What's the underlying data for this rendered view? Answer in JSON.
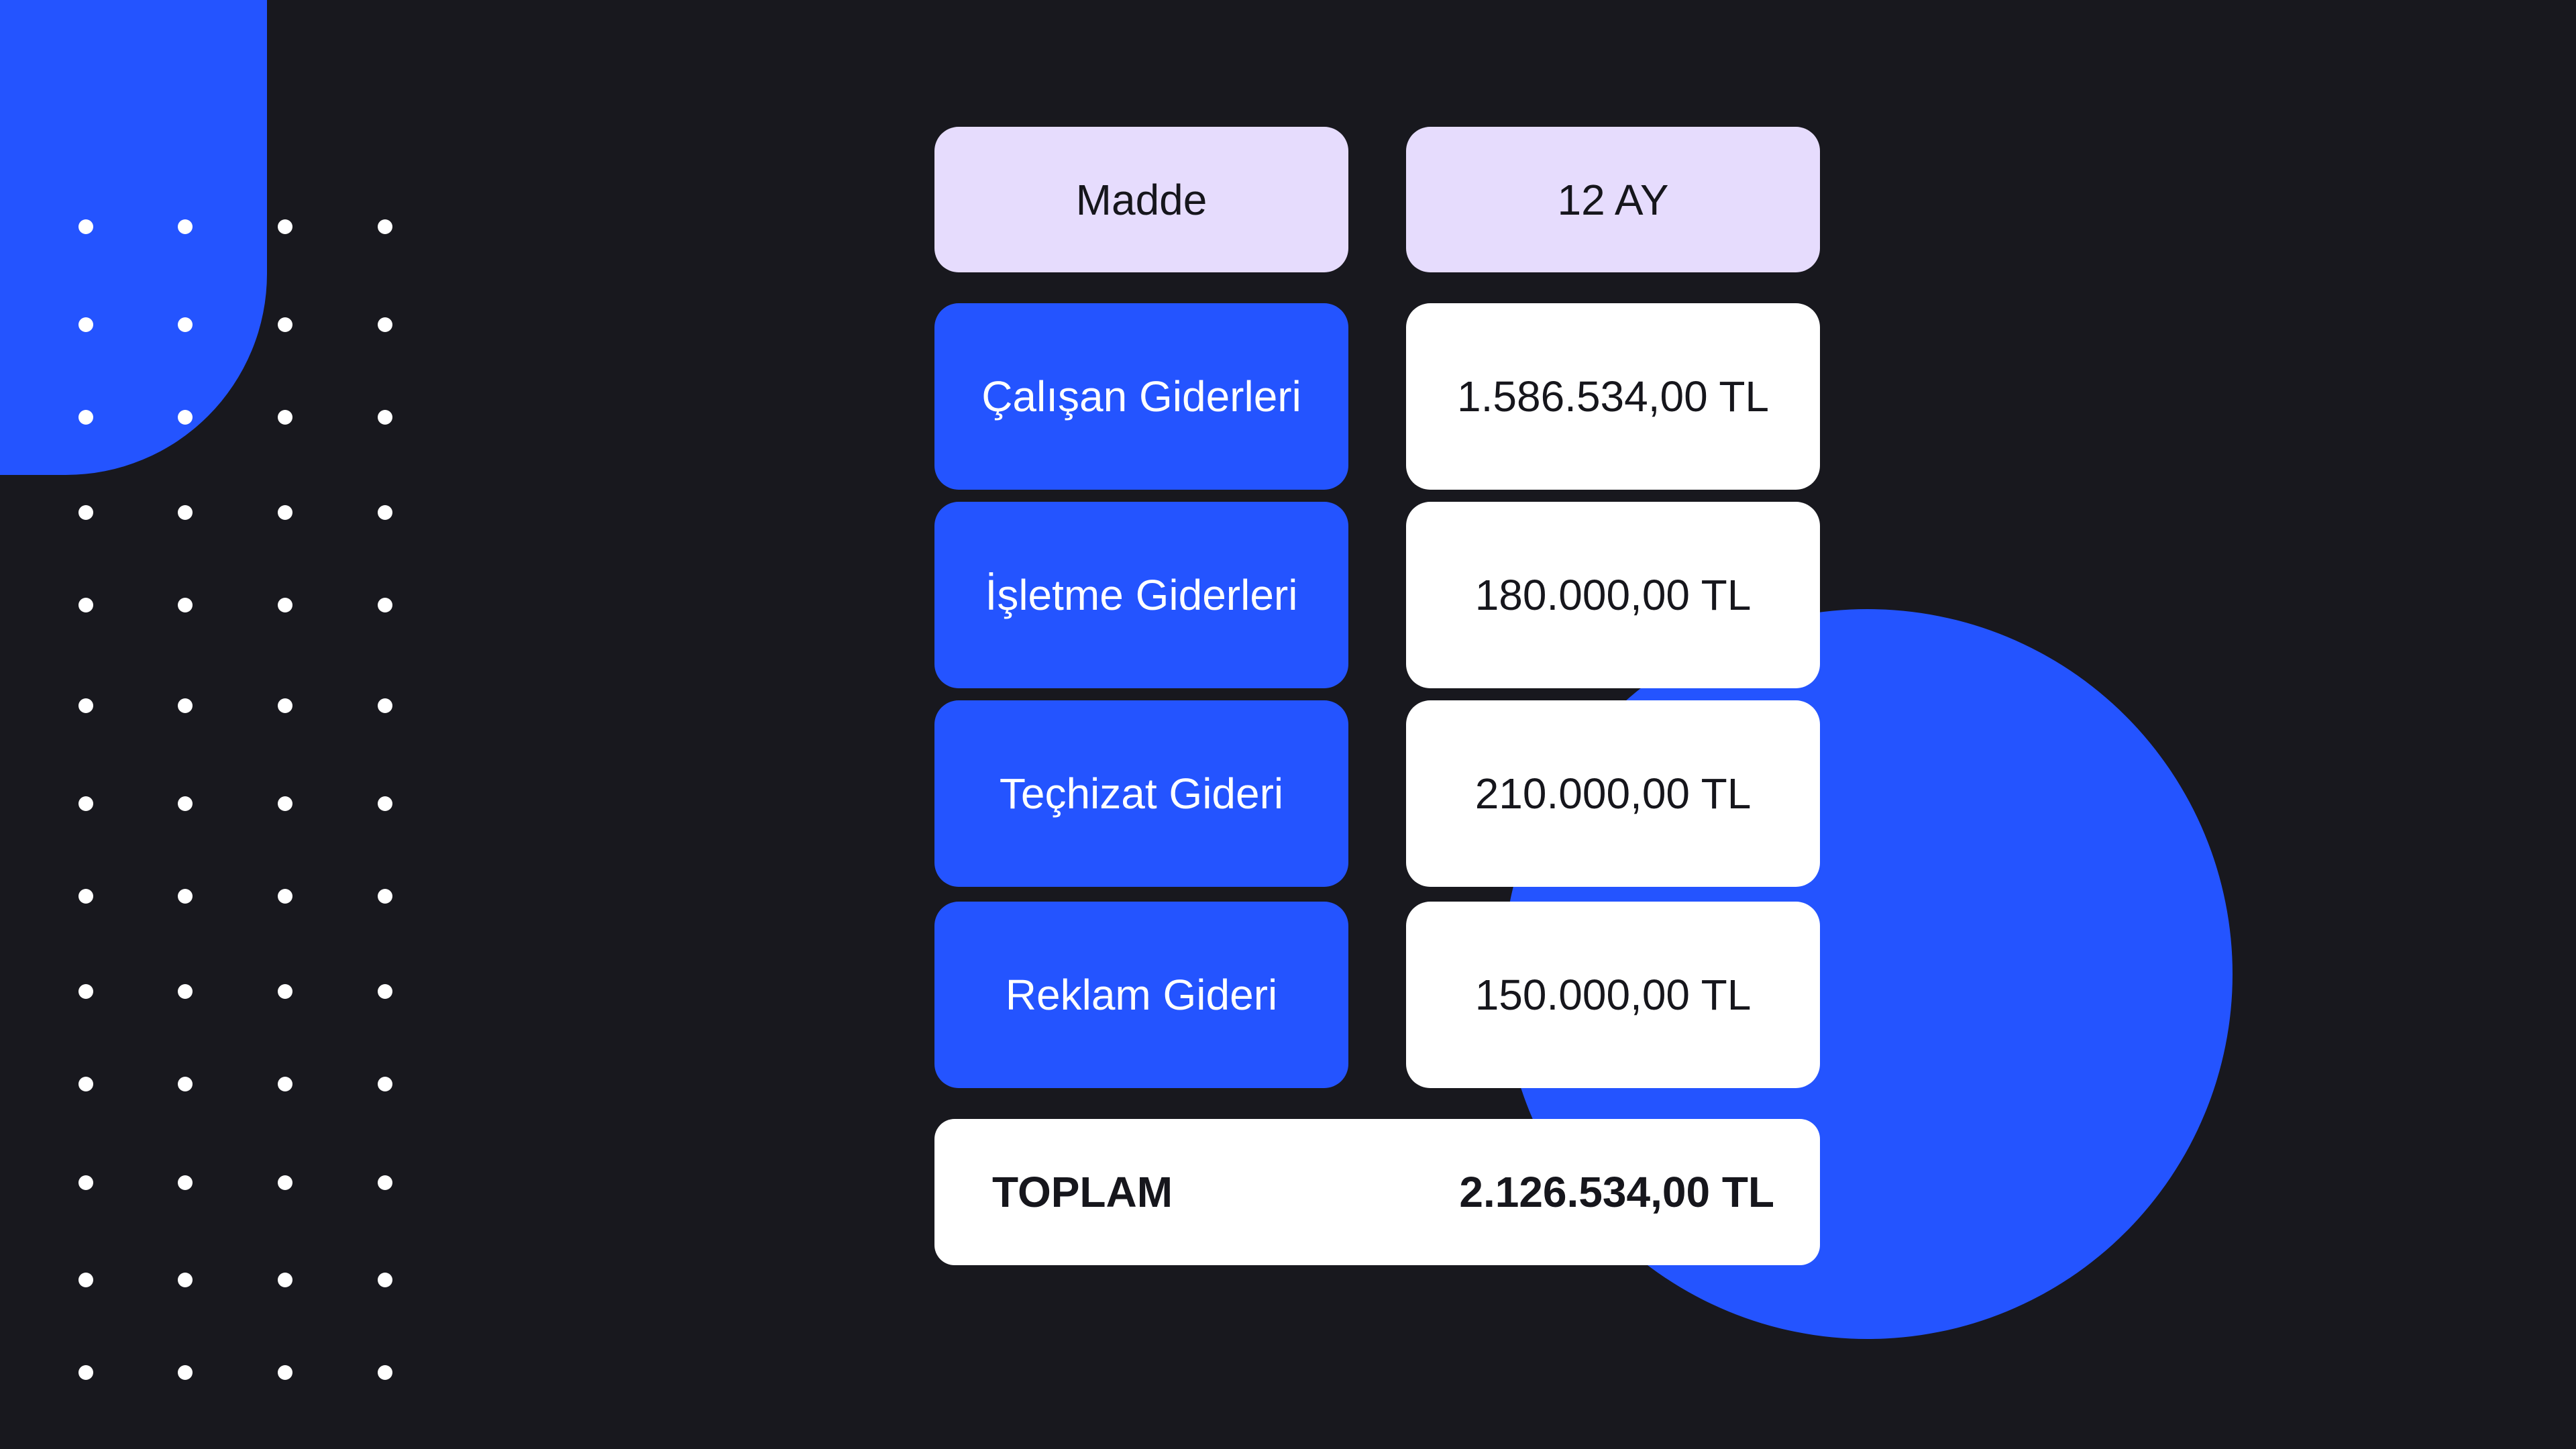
{
  "colors": {
    "background": "#18181e",
    "accent": "#2454ff",
    "header": "#e6dcfd",
    "card": "#ffffff"
  },
  "table": {
    "headers": [
      "Madde",
      "12 AY"
    ],
    "rows": [
      {
        "label": "Çalışan Giderleri",
        "value": "1.586.534,00 TL"
      },
      {
        "label": "İşletme Giderleri",
        "value": "180.000,00 TL"
      },
      {
        "label": "Teçhizat Gideri",
        "value": "210.000,00 TL"
      },
      {
        "label": "Reklam Gideri",
        "value": "150.000,00 TL"
      }
    ],
    "total": {
      "label": "TOPLAM",
      "value": "2.126.534,00 TL"
    }
  }
}
